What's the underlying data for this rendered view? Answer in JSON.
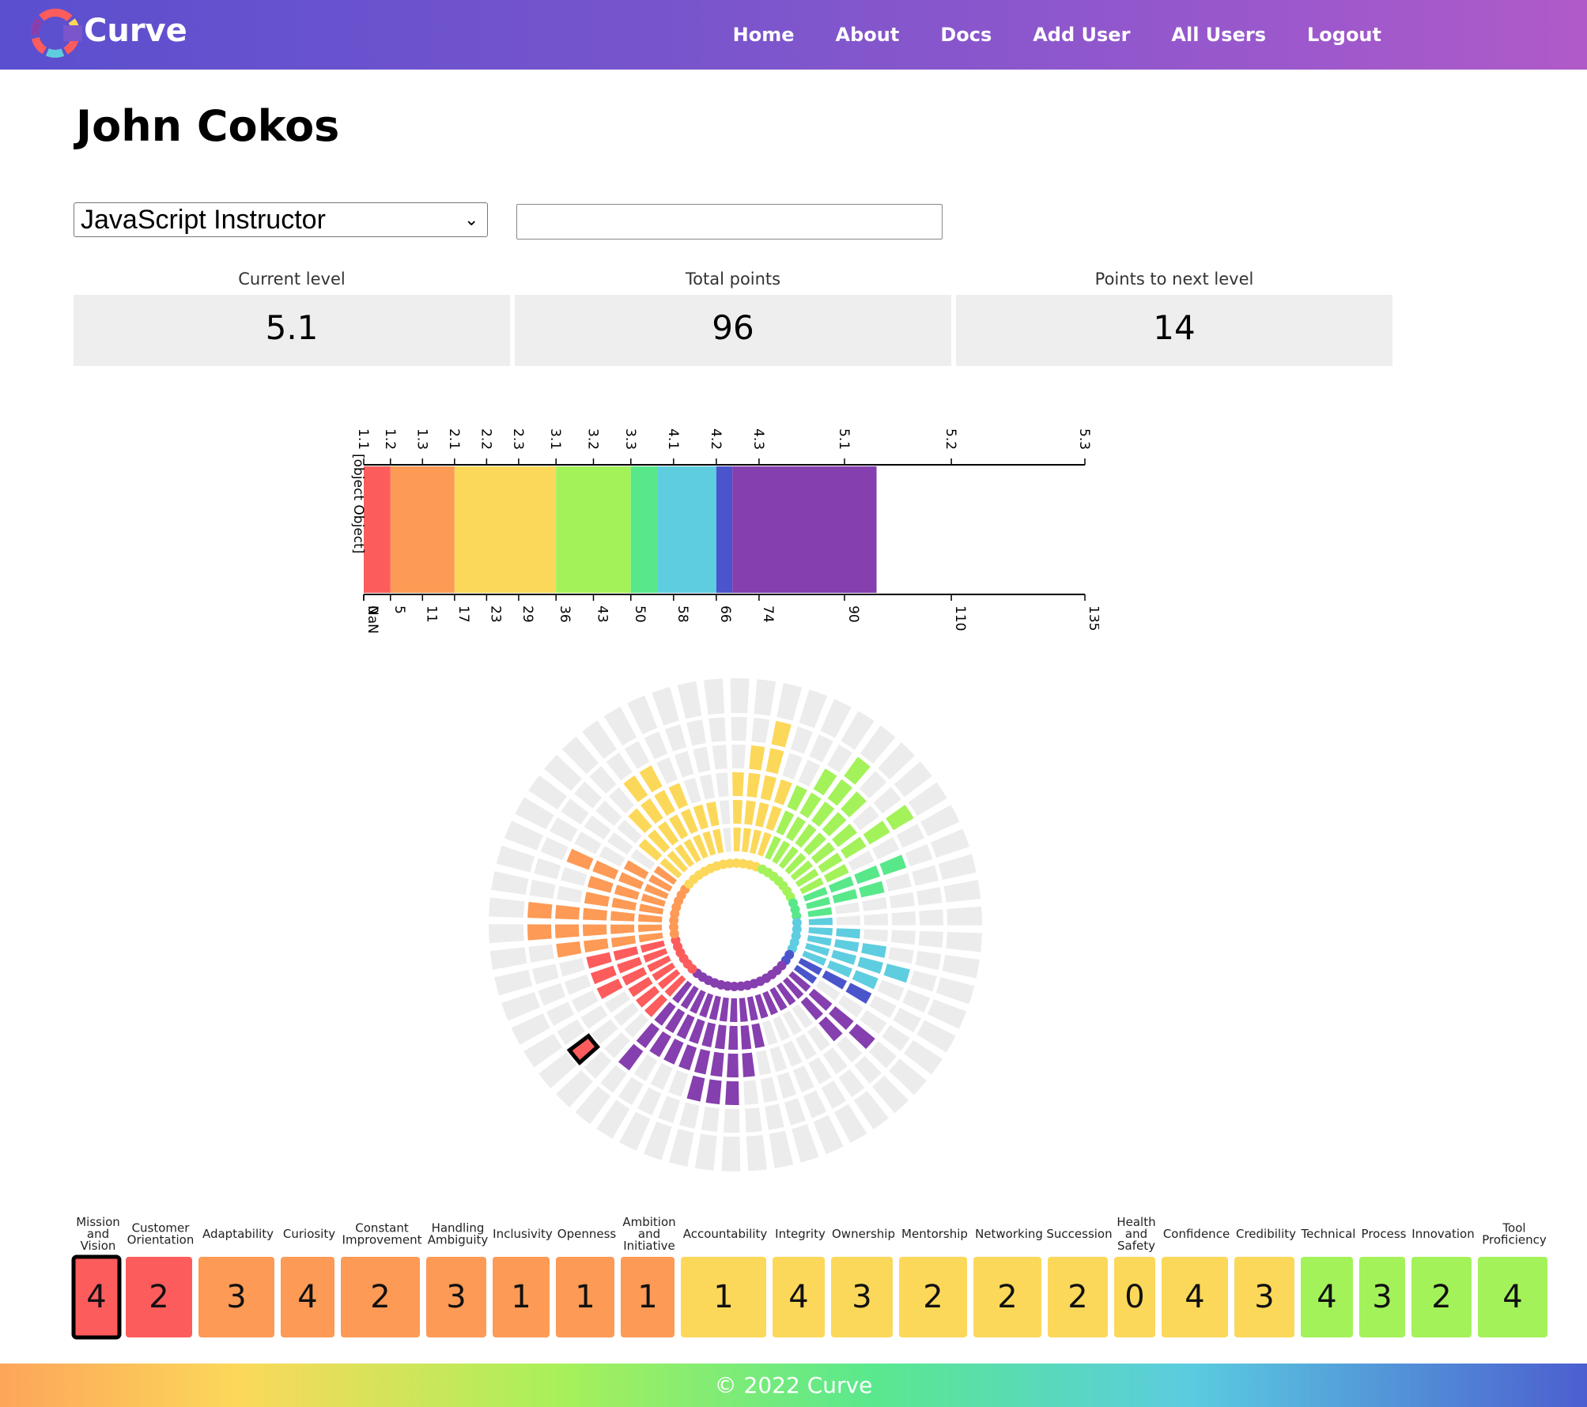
{
  "nav": {
    "brand": "Curve",
    "links": [
      "Home",
      "About",
      "Docs",
      "Add User",
      "All Users",
      "Logout"
    ]
  },
  "page": {
    "title": "John Cokos"
  },
  "role_select": {
    "value": "JavaScript Instructor"
  },
  "search": {
    "value": ""
  },
  "stats": [
    {
      "label": "Current level",
      "value": "5.1"
    },
    {
      "label": "Total points",
      "value": "96"
    },
    {
      "label": "Points to next level",
      "value": "14"
    }
  ],
  "level_bar": {
    "corner_label": "[object Object]",
    "top_ticks": [
      "1.1",
      "1.2",
      "1.3",
      "2.1",
      "2.2",
      "2.3",
      "3.1",
      "3.2",
      "3.3",
      "4.1",
      "4.2",
      "4.3",
      "5.1",
      "5.2",
      "5.3"
    ],
    "bottom_ticks": [
      "NaN",
      "0",
      "5",
      "11",
      "17",
      "23",
      "29",
      "36",
      "43",
      "50",
      "58",
      "66",
      "74",
      "90",
      "110",
      "135"
    ],
    "segments": [
      {
        "from": 0,
        "to": 5,
        "color": "#fd5c5c"
      },
      {
        "from": 5,
        "to": 17,
        "color": "#fd9a55"
      },
      {
        "from": 17,
        "to": 36,
        "color": "#fcd85a"
      },
      {
        "from": 36,
        "to": 50,
        "color": "#a3f25a"
      },
      {
        "from": 50,
        "to": 55,
        "color": "#58e88a"
      },
      {
        "from": 55,
        "to": 66,
        "color": "#5ecddf"
      },
      {
        "from": 66,
        "to": 69,
        "color": "#4a55cc"
      },
      {
        "from": 69,
        "to": 96,
        "color": "#863fae"
      }
    ]
  },
  "competencies": [
    {
      "name": "Mission and Vision",
      "score": "4",
      "color": "#fd5c5c",
      "selected": true
    },
    {
      "name": "Customer Orientation",
      "score": "2",
      "color": "#fd5c5c"
    },
    {
      "name": "Adaptability",
      "score": "3",
      "color": "#fd9a55"
    },
    {
      "name": "Curiosity",
      "score": "4",
      "color": "#fd9a55"
    },
    {
      "name": "Constant Improvement",
      "score": "2",
      "color": "#fd9a55"
    },
    {
      "name": "Handling Ambiguity",
      "score": "3",
      "color": "#fd9a55"
    },
    {
      "name": "Inclusivity",
      "score": "1",
      "color": "#fd9a55"
    },
    {
      "name": "Openness",
      "score": "1",
      "color": "#fd9a55"
    },
    {
      "name": "Ambition and Initiative",
      "score": "1",
      "color": "#fd9a55"
    },
    {
      "name": "Accountability",
      "score": "1",
      "color": "#fcd85a"
    },
    {
      "name": "Integrity",
      "score": "4",
      "color": "#fcd85a"
    },
    {
      "name": "Ownership",
      "score": "3",
      "color": "#fcd85a"
    },
    {
      "name": "Mentorship",
      "score": "2",
      "color": "#fcd85a"
    },
    {
      "name": "Networking",
      "score": "2",
      "color": "#fcd85a"
    },
    {
      "name": "Succession",
      "score": "2",
      "color": "#fcd85a"
    },
    {
      "name": "Health and Safety",
      "score": "0",
      "color": "#fcd85a"
    },
    {
      "name": "Confidence",
      "score": "4",
      "color": "#fcd85a"
    },
    {
      "name": "Credibility",
      "score": "3",
      "color": "#fcd85a"
    },
    {
      "name": "Technical",
      "score": "4",
      "color": "#a3f25a"
    },
    {
      "name": "Process",
      "score": "3",
      "color": "#a3f25a"
    },
    {
      "name": "Innovation",
      "score": "2",
      "color": "#a3f25a"
    },
    {
      "name": "Tool Proficiency",
      "score": "4",
      "color": "#a3f25a"
    }
  ],
  "wheel_sectors": [
    {
      "score": 3,
      "color": "#fd5c5c"
    },
    {
      "score": 3,
      "color": "#fd5c5c"
    },
    {
      "score": 3,
      "color": "#fd5c5c"
    },
    {
      "score": 4,
      "color": "#fd9a55"
    },
    {
      "score": 5,
      "color": "#fd9a55"
    },
    {
      "score": 5,
      "color": "#fd9a55"
    },
    {
      "score": 3,
      "color": "#fd9a55"
    },
    {
      "score": 3,
      "color": "#fd9a55"
    },
    {
      "score": 4,
      "color": "#fd9a55"
    },
    {
      "score": 2,
      "color": "#fd9a55"
    },
    {
      "score": 1,
      "color": "#fd9a55"
    },
    {
      "score": 2,
      "color": "#fcd85a"
    },
    {
      "score": 3,
      "color": "#fcd85a"
    },
    {
      "score": 4,
      "color": "#fcd85a"
    },
    {
      "score": 4,
      "color": "#fcd85a"
    },
    {
      "score": 3,
      "color": "#fcd85a"
    },
    {
      "score": 2,
      "color": "#fcd85a"
    },
    {
      "score": 2,
      "color": "#fcd85a"
    },
    {
      "score": 0,
      "color": "#fcd85a"
    },
    {
      "score": 3,
      "color": "#fcd85a"
    },
    {
      "score": 4,
      "color": "#fcd85a"
    },
    {
      "score": 5,
      "color": "#fcd85a"
    },
    {
      "score": 3,
      "color": "#fcd85a"
    },
    {
      "score": 3,
      "color": "#a3f25a"
    },
    {
      "score": 4,
      "color": "#a3f25a"
    },
    {
      "score": 5,
      "color": "#a3f25a"
    },
    {
      "score": 4,
      "color": "#a3f25a"
    },
    {
      "score": 3,
      "color": "#a3f25a"
    },
    {
      "score": 5,
      "color": "#a3f25a"
    },
    {
      "score": 2,
      "color": "#a3f25a"
    },
    {
      "score": 4,
      "color": "#58e88a"
    },
    {
      "score": 3,
      "color": "#58e88a"
    },
    {
      "score": 1,
      "color": "#58e88a"
    },
    {
      "score": 1,
      "color": "#5ecddf"
    },
    {
      "score": 2,
      "color": "#5ecddf"
    },
    {
      "score": 3,
      "color": "#5ecddf"
    },
    {
      "score": 4,
      "color": "#5ecddf"
    },
    {
      "score": 3,
      "color": "#5ecddf"
    },
    {
      "score": 3,
      "color": "#4a55cc"
    },
    {
      "score": 1,
      "color": "#4a55cc"
    },
    {
      "score": 4,
      "color": "#863fae"
    },
    {
      "score": 3,
      "color": "#863fae"
    },
    {
      "score": 1,
      "color": "#863fae"
    },
    {
      "score": 1,
      "color": "#863fae"
    },
    {
      "score": 1,
      "color": "#863fae"
    },
    {
      "score": 1,
      "color": "#863fae"
    },
    {
      "score": 2,
      "color": "#863fae"
    },
    {
      "score": 3,
      "color": "#863fae"
    },
    {
      "score": 4,
      "color": "#863fae"
    },
    {
      "score": 4,
      "color": "#863fae"
    },
    {
      "score": 4,
      "color": "#863fae"
    },
    {
      "score": 3,
      "color": "#863fae"
    },
    {
      "score": 3,
      "color": "#863fae"
    },
    {
      "score": 3,
      "color": "#863fae"
    },
    {
      "score": 4,
      "color": "#863fae"
    },
    {
      "score": 2,
      "color": "#fd5c5c"
    },
    {
      "score": 2,
      "color": "#fd5c5c"
    },
    {
      "score": 2,
      "color": "#fd5c5c"
    }
  ],
  "footer": {
    "text": "© 2022 Curve"
  }
}
